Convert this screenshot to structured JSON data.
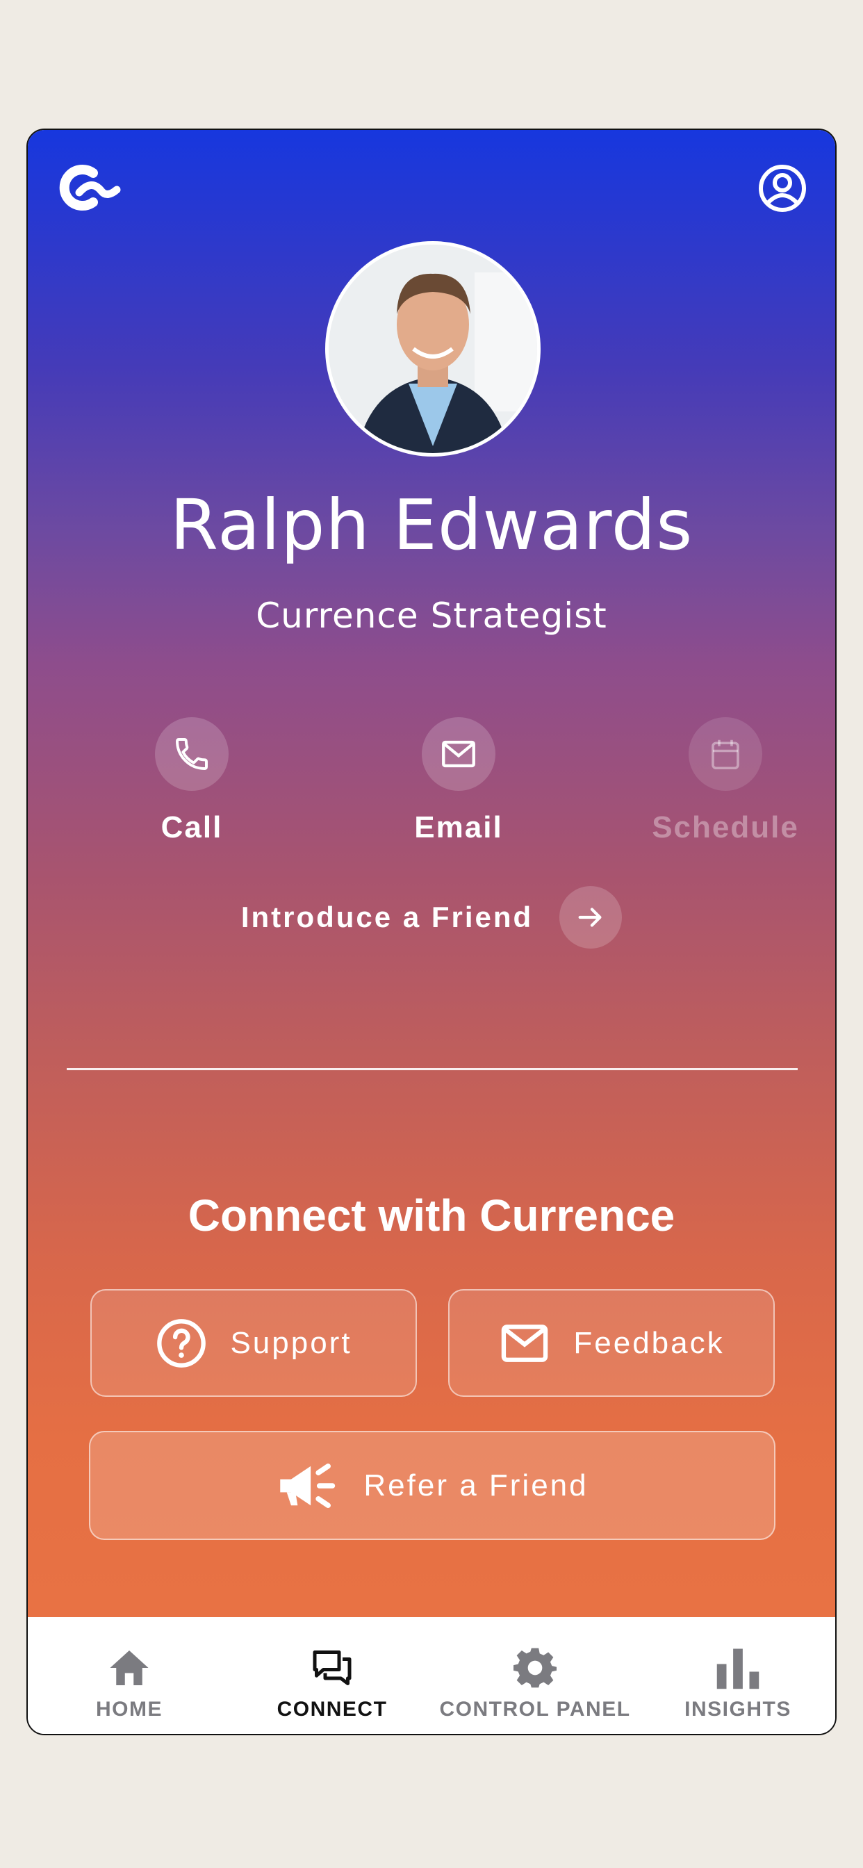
{
  "profile": {
    "name": "Ralph Edwards",
    "title": "Currence Strategist"
  },
  "actions": [
    {
      "label": "Call",
      "icon": "phone-icon",
      "enabled": true
    },
    {
      "label": "Email",
      "icon": "mail-icon",
      "enabled": true
    },
    {
      "label": "Schedule",
      "icon": "calendar-icon",
      "enabled": false
    }
  ],
  "introduce": {
    "label": "Introduce a Friend",
    "icon": "arrow-right-icon"
  },
  "connect": {
    "title": "Connect with Currence",
    "support_label": "Support",
    "feedback_label": "Feedback",
    "refer_label": "Refer a Friend"
  },
  "tabs": [
    {
      "label": "HOME",
      "icon": "home-icon",
      "active": false
    },
    {
      "label": "CONNECT",
      "icon": "chat-icon",
      "active": true
    },
    {
      "label": "CONTROL PANEL",
      "icon": "gear-icon",
      "active": false
    },
    {
      "label": "INSIGHTS",
      "icon": "bar-chart-icon",
      "active": false
    }
  ],
  "colors": {
    "gradient_top": "#1737de",
    "gradient_mid": "#8e4d8c",
    "gradient_bottom": "#e87244",
    "background": "#efebe4",
    "tab_active": "#111111",
    "tab_inactive": "#7b7b80"
  }
}
